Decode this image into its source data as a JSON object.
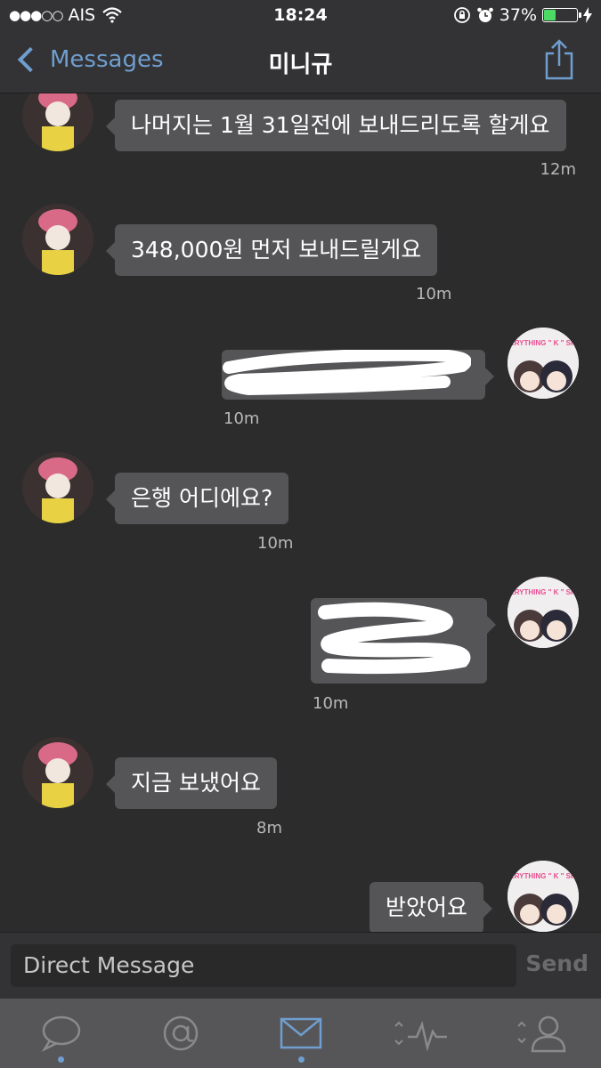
{
  "status_bar": {
    "signal_dots": "●●●○○",
    "carrier": "AIS",
    "time": "18:24",
    "battery_percent": "37%",
    "battery_level": 0.37
  },
  "nav": {
    "back_label": "Messages",
    "title": "미니규"
  },
  "messages": [
    {
      "text": "나머지는 1월 31일전에 보내드리도록 할게요",
      "time": "12m"
    },
    {
      "text": "348,000원 먼저 보내드릴게요",
      "time": "10m"
    },
    {
      "text": "",
      "time": "10m"
    },
    {
      "text": "은행 어디에요?",
      "time": "10m"
    },
    {
      "text": "",
      "time": "10m"
    },
    {
      "text": "지금 보냈어요",
      "time": "8m"
    },
    {
      "text": "받았어요",
      "time": ""
    }
  ],
  "avatar_me_text": "EVERYTHING \" K \" SHOP",
  "composer": {
    "placeholder": "Direct Message",
    "send_label": "Send"
  },
  "tabs": [
    "timeline",
    "mentions",
    "messages",
    "activity",
    "profile"
  ],
  "colors": {
    "accent": "#6f9ecf",
    "bubble": "#555558",
    "background": "#2c2c2d",
    "battery": "#4cd964"
  }
}
